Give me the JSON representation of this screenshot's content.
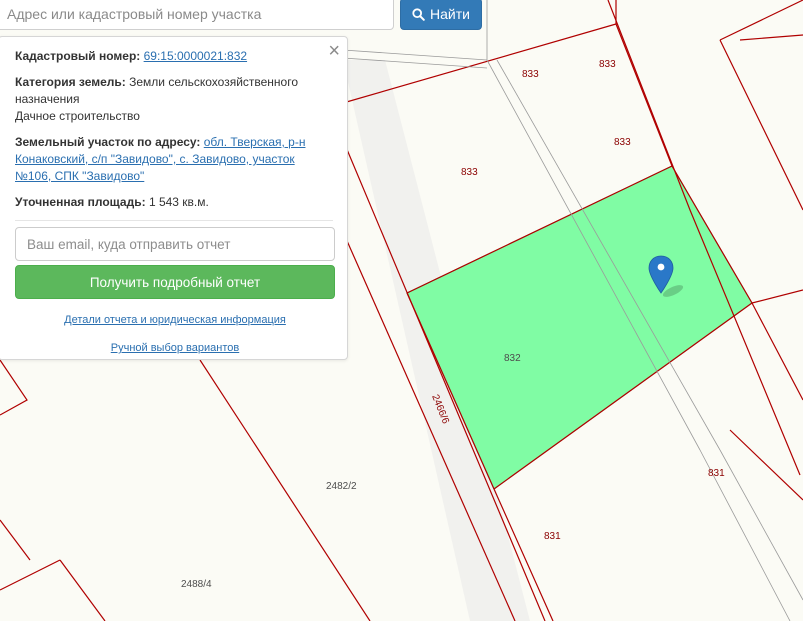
{
  "search": {
    "placeholder": "Адрес или кадастровый номер участка",
    "button_label": "Найти",
    "button_icon": "search-icon"
  },
  "popup": {
    "cadastral_label": "Кадастровый номер:",
    "cadastral_value": "69:15:0000021:832",
    "category_label": "Категория земель:",
    "category_value": "Земли сельскохозяйственного назначения",
    "usage_value": "Дачное строительство",
    "address_label": "Земельный участок по адресу:",
    "address_value": "обл. Тверская, р-н Конаковский, с/п \"Завидово\", с. Завидово, участок №106, СПК \"Завидово\"",
    "area_label": "Уточненная площадь:",
    "area_value": "1 543 кв.м.",
    "email_placeholder": "Ваш email, куда отправить отчет",
    "report_button_label": "Получить подробный отчет",
    "details_link": "Детали отчета и юридическая информация",
    "manual_select_link": "Ручной выбор вариантов",
    "close_glyph": "×"
  },
  "map": {
    "highlight_color": "#80fca4",
    "boundary_color": "#b00000",
    "marker_color": "#2a78c8",
    "labels": {
      "l833a": "833",
      "l833b": "833",
      "l833c": "833",
      "l833d": "833",
      "l832": "832",
      "l831a": "831",
      "l831b": "831",
      "l2466": "2466/6",
      "l2482": "2482/2",
      "l2488": "2488/4"
    }
  }
}
